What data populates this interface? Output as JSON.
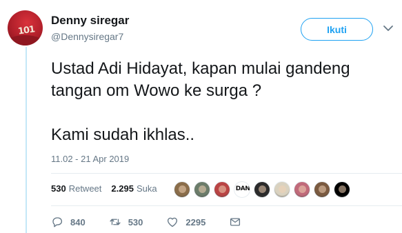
{
  "author": {
    "name": "Denny siregar",
    "handle": "@Dennysiregar7",
    "avatar_jersey_number": "101"
  },
  "follow_label": "Ikuti",
  "tweet": {
    "lines": [
      "Ustad Adi Hidayat, kapan mulai gandeng",
      "tangan om Wowo ke surga ?",
      "Kami sudah ikhlas.."
    ]
  },
  "timestamp": "11.02 - 21 Apr 2019",
  "stats": {
    "retweets_count": "530",
    "retweets_label": "Retweet",
    "likes_count": "2.295",
    "likes_label": "Suka"
  },
  "likers": [
    {
      "color": "#8a6d4a"
    },
    {
      "color": "#6b7c6a"
    },
    {
      "color": "#b94444"
    },
    {
      "tag": "DAN",
      "color": "#ffffff"
    },
    {
      "color": "#2b2b2b"
    },
    {
      "color": "#d9d2c0"
    },
    {
      "color": "#c06a7a"
    },
    {
      "color": "#7a5a40"
    },
    {
      "color": "#000000"
    }
  ],
  "actions": {
    "reply_count": "840",
    "retweet_count": "530",
    "like_count": "2295"
  },
  "colors": {
    "accent": "#1da1f2",
    "secondary_text": "#657786",
    "thread_line": "#c4e7f7"
  }
}
